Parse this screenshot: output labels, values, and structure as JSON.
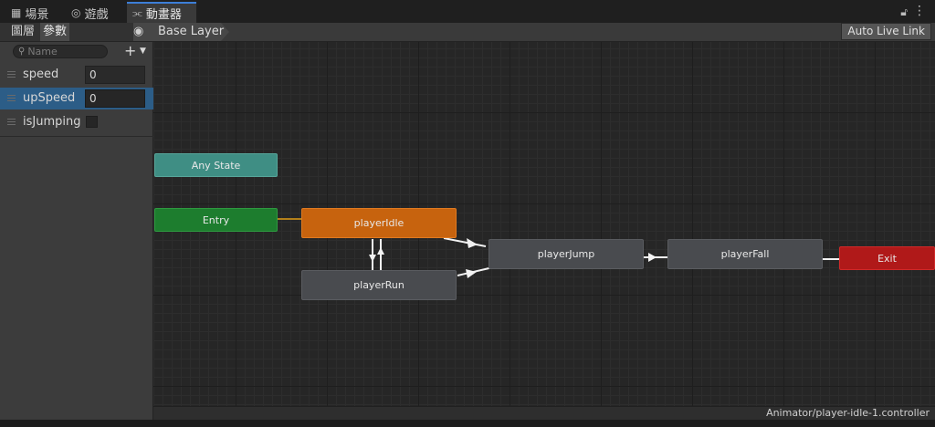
{
  "tabs": [
    {
      "icon": "grid-icon",
      "label": "場景"
    },
    {
      "icon": "gamepad-icon",
      "label": "遊戲"
    },
    {
      "icon": "animator-icon",
      "label": "動畫器"
    }
  ],
  "left_panel": {
    "tabs": [
      "圖層",
      "參數"
    ],
    "search_placeholder": "Name",
    "parameters": [
      {
        "name": "speed",
        "type": "float",
        "value": "0"
      },
      {
        "name": "upSpeed",
        "type": "float",
        "value": "0",
        "selected": true
      },
      {
        "name": "isJumping",
        "type": "bool",
        "value": false
      }
    ]
  },
  "graph": {
    "breadcrumb": "Base Layer",
    "auto_live_link": "Auto Live Link",
    "states": {
      "any_state": "Any State",
      "entry": "Entry",
      "player_idle": "playerIdle",
      "player_run": "playerRun",
      "player_jump": "playerJump",
      "player_fall": "playerFall",
      "exit": "Exit"
    }
  },
  "status": {
    "path": "Animator/player-idle-1.controller"
  },
  "colors": {
    "any_state": "#3f8e84",
    "entry": "#1d7d2e",
    "default_state": "#c7630e",
    "exit": "#b01919",
    "selection": "#2c5d87"
  }
}
